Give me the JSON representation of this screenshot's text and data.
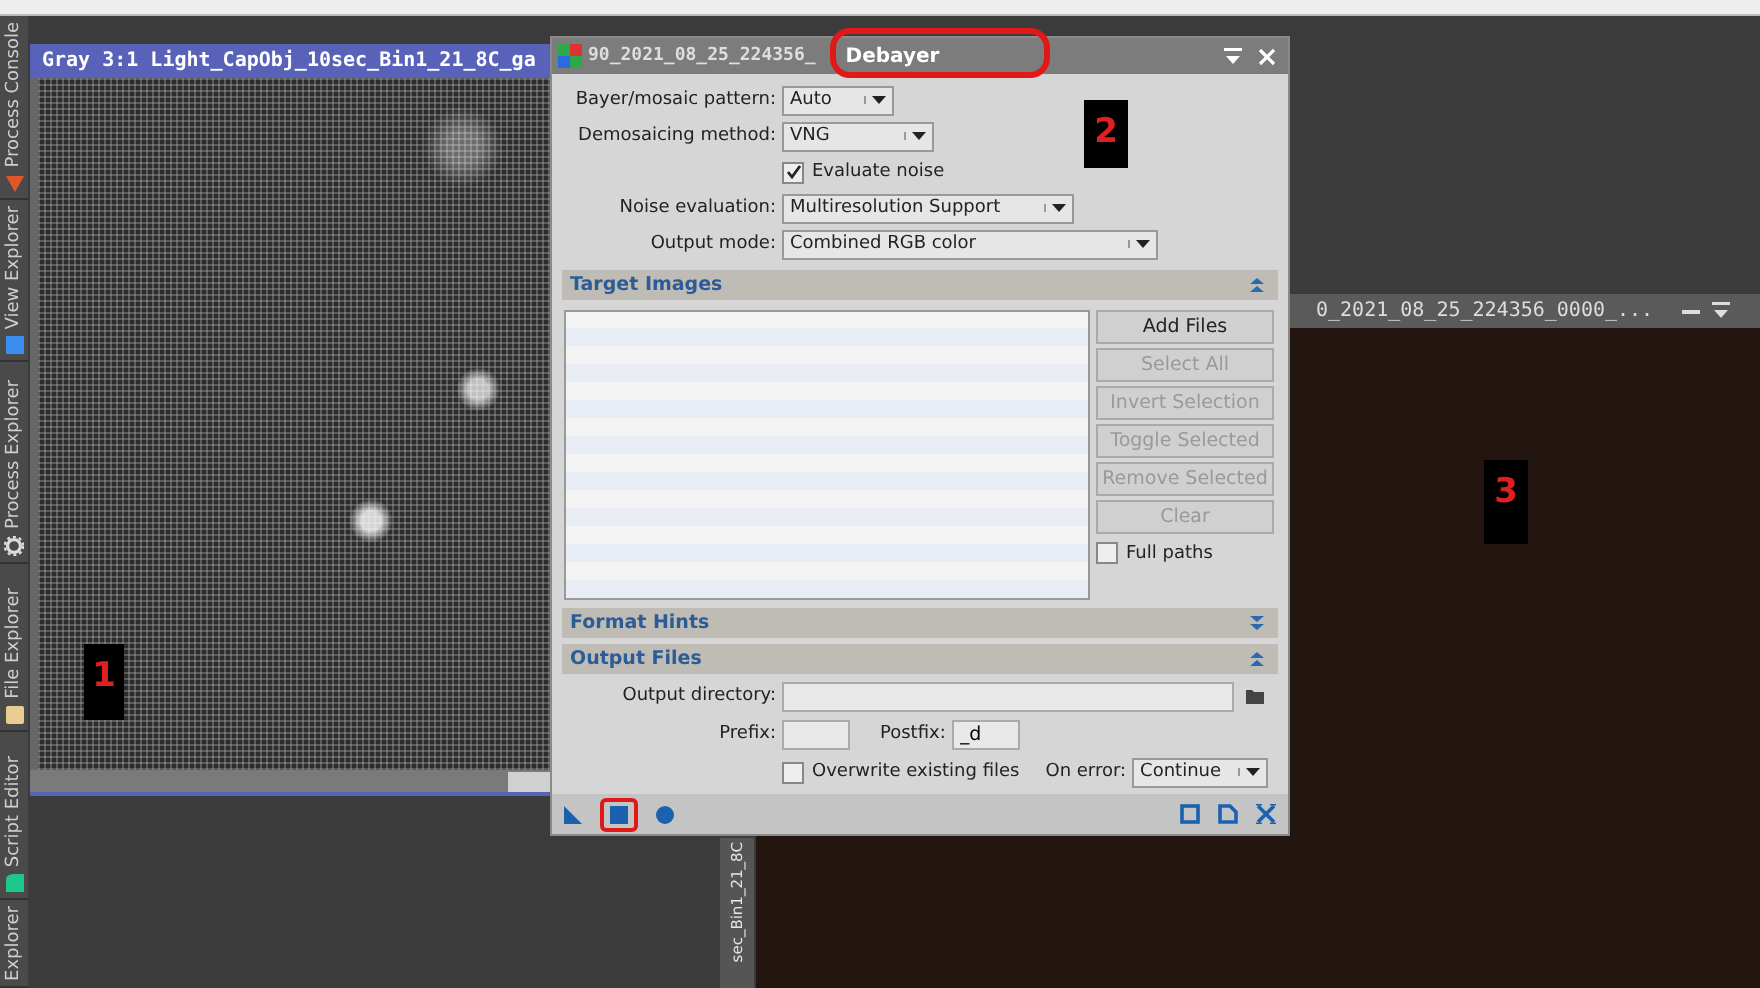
{
  "sidebar": {
    "tabs": [
      {
        "label": "Process Console"
      },
      {
        "label": "View Explorer"
      },
      {
        "label": "Process Explorer"
      },
      {
        "label": "File Explorer"
      },
      {
        "label": "Script Editor"
      },
      {
        "label": "Explorer"
      }
    ]
  },
  "image_windows": [
    {
      "title": "Gray 3:1 Light_CapObj_10sec_Bin1_21_8C_ga",
      "kind": "mono",
      "annotation": "1"
    },
    {
      "title": "0_2021_08_25_224356_0000_...",
      "kind": "color",
      "annotation": "3"
    }
  ],
  "iconized_view": {
    "label": "sec_Bin1_21_8C"
  },
  "dialog": {
    "title": "Debayer",
    "background_title": "90_2021_08_25_224356_",
    "annotation": "2",
    "fields": [
      {
        "kind": "select",
        "label": "Bayer/mosaic pattern:",
        "value": "Auto"
      },
      {
        "kind": "select",
        "label": "Demosaicing method:",
        "value": "VNG"
      },
      {
        "kind": "checkbox",
        "label": "Evaluate noise",
        "checked": true
      },
      {
        "kind": "select",
        "label": "Noise evaluation:",
        "value": "Multiresolution Support"
      },
      {
        "kind": "select",
        "label": "Output mode:",
        "value": "Combined RGB color"
      }
    ],
    "target_images": {
      "title": "Target Images",
      "expanded": true,
      "buttons": [
        {
          "label": "Add Files",
          "disabled": false
        },
        {
          "label": "Select All",
          "disabled": true
        },
        {
          "label": "Invert Selection",
          "disabled": true
        },
        {
          "label": "Toggle Selected",
          "disabled": true
        },
        {
          "label": "Remove Selected",
          "disabled": true
        },
        {
          "label": "Clear",
          "disabled": true
        }
      ],
      "full_paths": {
        "label": "Full paths",
        "checked": false
      }
    },
    "format_hints": {
      "title": "Format Hints",
      "expanded": false
    },
    "output_files": {
      "title": "Output Files",
      "expanded": true,
      "output_directory": {
        "label": "Output directory:"
      },
      "prefix": {
        "label": "Prefix:"
      },
      "postfix": {
        "label": "Postfix:",
        "value": "_d"
      },
      "overwrite": {
        "label": "Overwrite existing files",
        "checked": false
      },
      "on_error": {
        "label": "On error:",
        "value": "Continue"
      }
    }
  }
}
